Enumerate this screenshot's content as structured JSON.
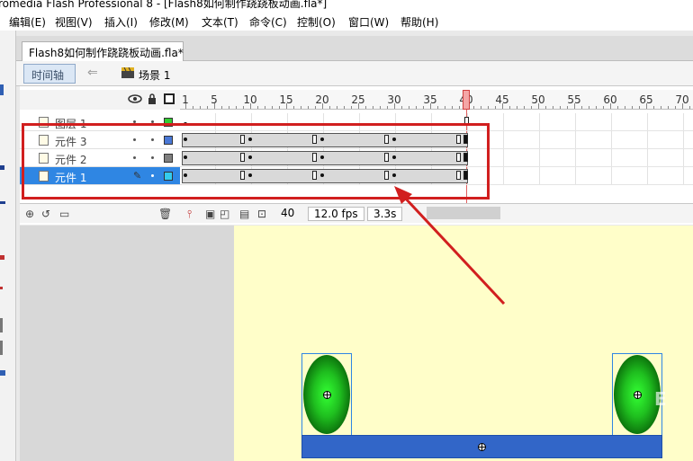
{
  "window": {
    "title": "romedia Flash Professional 8 - [Flash8如何制作跷跷板动画.fla*]"
  },
  "menu": [
    {
      "id": "edit",
      "label": "编辑(E)"
    },
    {
      "id": "view",
      "label": "视图(V)"
    },
    {
      "id": "insert",
      "label": "插入(I)"
    },
    {
      "id": "modify",
      "label": "修改(M)"
    },
    {
      "id": "text",
      "label": "文本(T)"
    },
    {
      "id": "commands",
      "label": "命令(C)"
    },
    {
      "id": "control",
      "label": "控制(O)"
    },
    {
      "id": "window",
      "label": "窗口(W)"
    },
    {
      "id": "help",
      "label": "帮助(H)"
    }
  ],
  "document_tab": {
    "label": "Flash8如何制作跷跷板动画.fla*"
  },
  "editbar": {
    "timeline_button": "时间轴",
    "scene_label": "场景 1"
  },
  "timeline": {
    "ruler_labels": [
      "1",
      "5",
      "10",
      "15",
      "20",
      "25",
      "30",
      "35",
      "40",
      "45",
      "50",
      "55",
      "60",
      "65",
      "70"
    ],
    "playhead_frame": 40,
    "layers": [
      {
        "name": "图层 1",
        "color": "#33cc33",
        "selected": false
      },
      {
        "name": "元件 3",
        "color": "#4a78d6",
        "selected": false
      },
      {
        "name": "元件 2",
        "color": "#808080",
        "selected": false
      },
      {
        "name": "元件 1",
        "color": "#33ccee",
        "selected": true
      }
    ],
    "footer": {
      "current_frame": "40",
      "frame_rate": "12.0 fps",
      "elapsed": "3.3s"
    }
  },
  "colors": {
    "selection": "#2f86e3",
    "annotation": "#d11f1f",
    "stage": "#fffec9",
    "board": "#3266c8"
  },
  "watermark": "E"
}
